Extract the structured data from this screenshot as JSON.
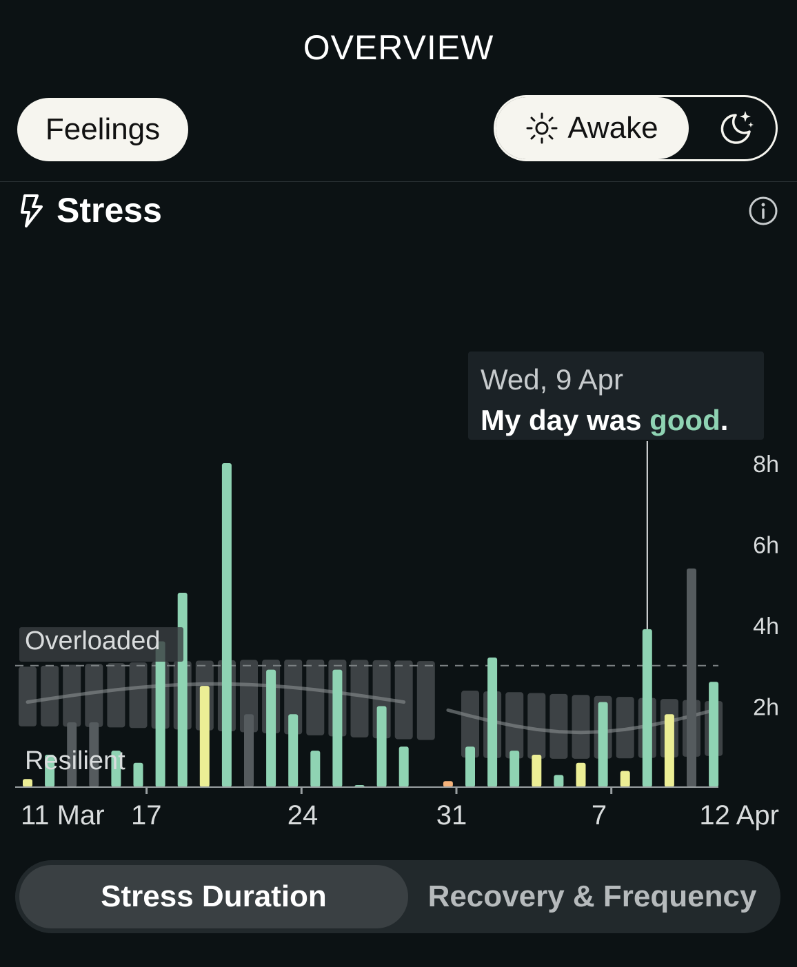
{
  "header": {
    "title": "OVERVIEW"
  },
  "controls": {
    "feelings_label": "Feelings",
    "awake_label": "Awake",
    "icons": {
      "awake": "sun-icon",
      "sleep": "moon-stars-icon"
    }
  },
  "section": {
    "title": "Stress",
    "icon": "lightning-bolt-icon",
    "info_icon": "info-icon"
  },
  "tooltip": {
    "date": "Wed, 9 Apr",
    "prefix": "My day was ",
    "highlight": "good",
    "suffix": "."
  },
  "tabs": {
    "duration": "Stress Duration",
    "recovery": "Recovery & Frequency"
  },
  "colors": {
    "green": "#8fd3b3",
    "yellow": "#ecee95",
    "orange": "#f4b27a",
    "gray": "#555b5e",
    "band": "#464b4d"
  },
  "chart_data": {
    "type": "bar",
    "ylim": [
      0,
      8
    ],
    "y_ticks": [
      "2h",
      "4h",
      "6h",
      "8h"
    ],
    "x_labels": [
      "11 Mar",
      "17",
      "24",
      "31",
      "7",
      "12 Apr"
    ],
    "zone_labels": [
      "Overloaded",
      "Resilient"
    ],
    "threshold": 3,
    "bars": [
      {
        "date": "11 Mar",
        "value": 0.2,
        "color": "yellow"
      },
      {
        "date": "12 Mar",
        "value": 0.8,
        "color": "green"
      },
      {
        "date": "13 Mar",
        "value": 1.6,
        "color": "gray"
      },
      {
        "date": "14 Mar",
        "value": 1.6,
        "color": "gray"
      },
      {
        "date": "15 Mar",
        "value": 0.9,
        "color": "green"
      },
      {
        "date": "16 Mar",
        "value": 0.6,
        "color": "green"
      },
      {
        "date": "17 Mar",
        "value": 3.6,
        "color": "green"
      },
      {
        "date": "18 Mar",
        "value": 4.8,
        "color": "green"
      },
      {
        "date": "19 Mar",
        "value": 2.5,
        "color": "yellow"
      },
      {
        "date": "20 Mar",
        "value": 8.0,
        "color": "green"
      },
      {
        "date": "21 Mar",
        "value": 1.8,
        "color": "gray"
      },
      {
        "date": "22 Mar",
        "value": 2.9,
        "color": "green"
      },
      {
        "date": "23 Mar",
        "value": 1.8,
        "color": "green"
      },
      {
        "date": "24 Mar",
        "value": 0.9,
        "color": "green"
      },
      {
        "date": "25 Mar",
        "value": 2.9,
        "color": "green"
      },
      {
        "date": "26 Mar",
        "value": 0.05,
        "color": "green"
      },
      {
        "date": "27 Mar",
        "value": 2.0,
        "color": "green"
      },
      {
        "date": "28 Mar",
        "value": 1.0,
        "color": "green"
      },
      {
        "date": "30 Mar",
        "value": 0.15,
        "color": "orange"
      },
      {
        "date": "31 Mar",
        "value": 1.0,
        "color": "green"
      },
      {
        "date": "1 Apr",
        "value": 3.2,
        "color": "green"
      },
      {
        "date": "2 Apr",
        "value": 0.9,
        "color": "green"
      },
      {
        "date": "3 Apr",
        "value": 0.8,
        "color": "yellow"
      },
      {
        "date": "4 Apr",
        "value": 0.3,
        "color": "green"
      },
      {
        "date": "5 Apr",
        "value": 0.6,
        "color": "yellow"
      },
      {
        "date": "6 Apr",
        "value": 2.1,
        "color": "green"
      },
      {
        "date": "7 Apr",
        "value": 0.4,
        "color": "yellow"
      },
      {
        "date": "8 Apr",
        "value": 3.9,
        "color": "green"
      },
      {
        "date": "9 Apr",
        "value": 1.8,
        "color": "yellow"
      },
      {
        "date": "10 Apr",
        "value": 5.4,
        "color": "gray"
      },
      {
        "date": "11 Apr",
        "value": 2.6,
        "color": "green"
      }
    ]
  }
}
